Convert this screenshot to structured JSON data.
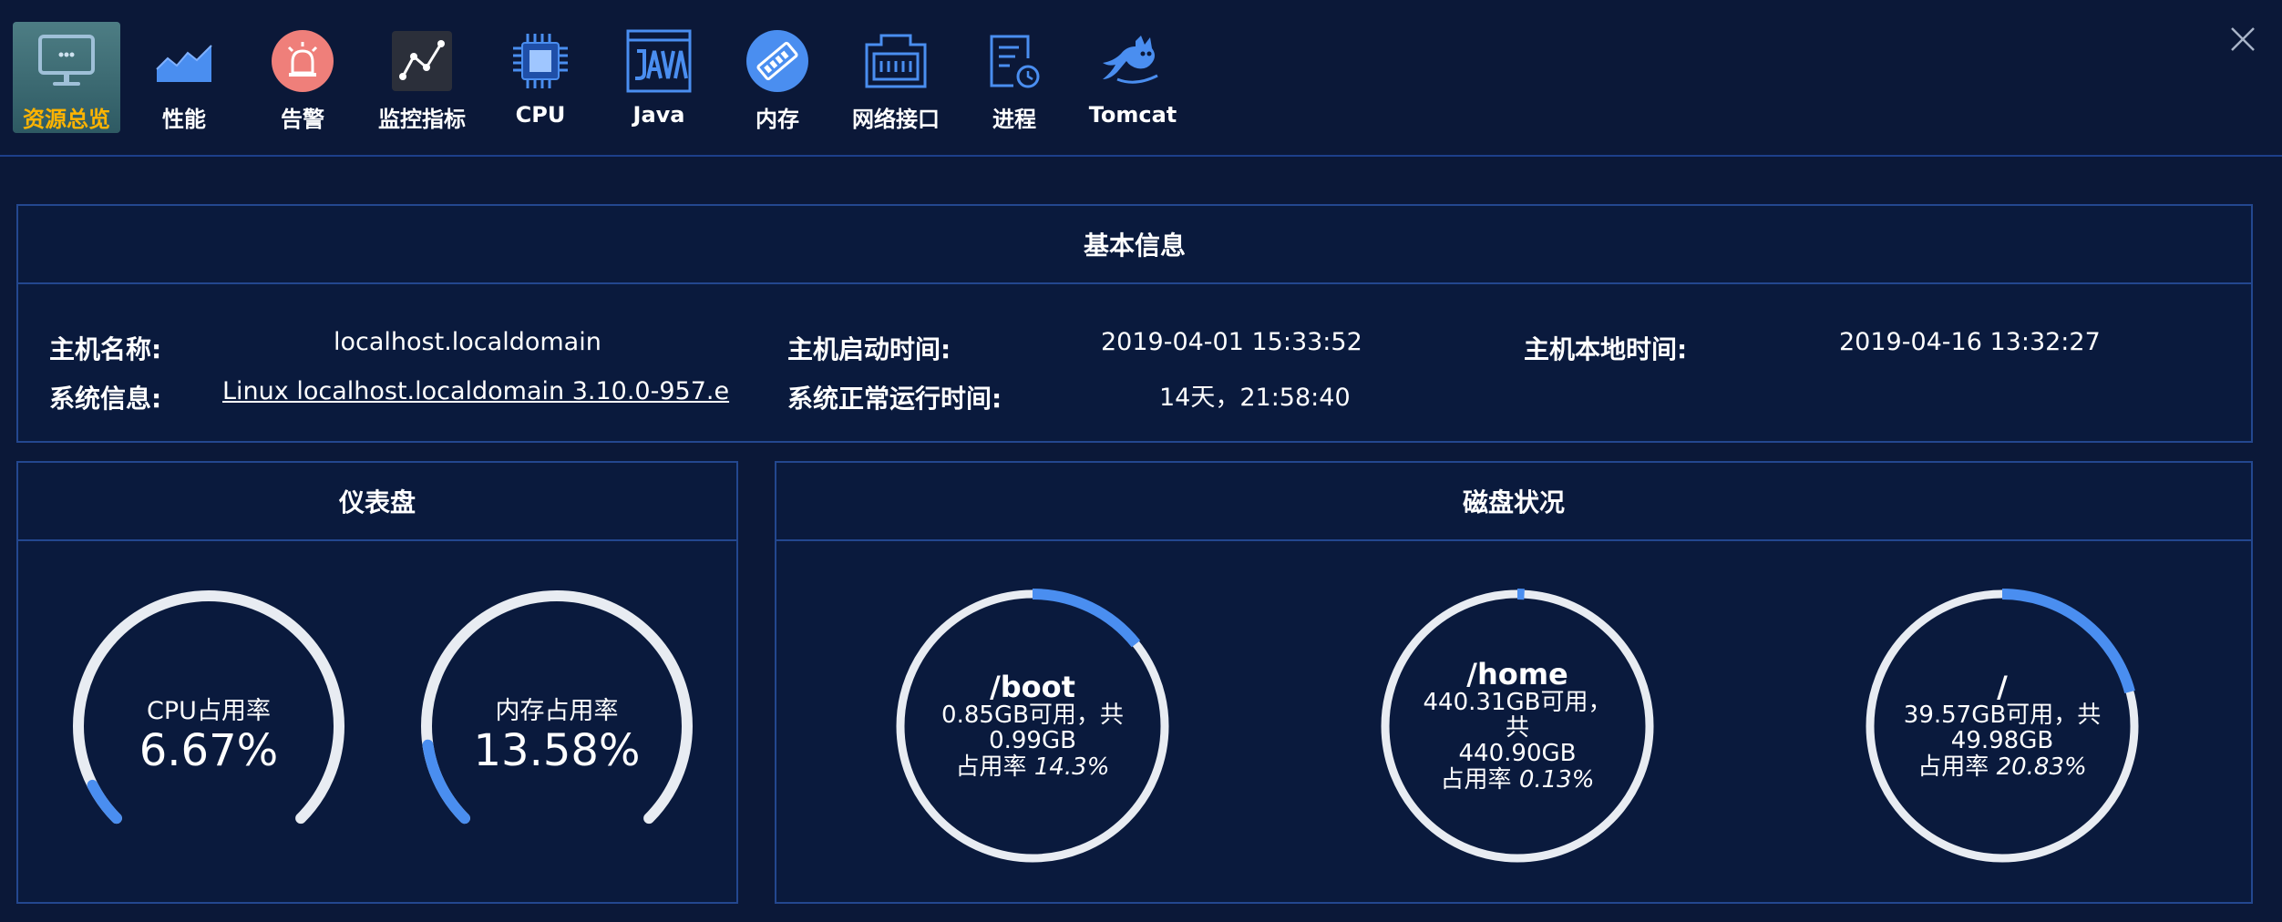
{
  "toolbar": {
    "items": [
      {
        "label": "资源总览",
        "icon": "monitor-icon",
        "active": true
      },
      {
        "label": "性能",
        "icon": "area-chart-icon",
        "active": false
      },
      {
        "label": "告警",
        "icon": "alarm-icon",
        "active": false
      },
      {
        "label": "监控指标",
        "icon": "line-chart-icon",
        "active": false
      },
      {
        "label": "CPU",
        "icon": "cpu-chip-icon",
        "active": false
      },
      {
        "label": "Java",
        "icon": "java-icon",
        "active": false
      },
      {
        "label": "内存",
        "icon": "memory-icon",
        "active": false
      },
      {
        "label": "网络接口",
        "icon": "network-port-icon",
        "active": false
      },
      {
        "label": "进程",
        "icon": "process-icon",
        "active": false
      },
      {
        "label": "Tomcat",
        "icon": "tomcat-icon",
        "active": false
      }
    ]
  },
  "basic_info": {
    "title": "基本信息",
    "hostname_label": "主机名称:",
    "hostname": "localhost.localdomain",
    "boot_time_label": "主机启动时间:",
    "boot_time": "2019-04-01 15:33:52",
    "local_time_label": "主机本地时间:",
    "local_time": "2019-04-16 13:32:27",
    "sysinfo_label": "系统信息:",
    "sysinfo": "Linux localhost.localdomain 3.10.0-957.e",
    "uptime_label": "系统正常运行时间:",
    "uptime": "14天，21:58:40"
  },
  "dashboard": {
    "title": "仪表盘",
    "gauges": [
      {
        "title": "CPU占用率",
        "value": "6.67%",
        "fraction": 0.0667
      },
      {
        "title": "内存占用率",
        "value": "13.58%",
        "fraction": 0.1358
      }
    ]
  },
  "disk": {
    "title": "磁盘状况",
    "items": [
      {
        "name": "/boot",
        "line1": "0.85GB可用，共",
        "line2": "0.99GB",
        "rate_label": "占用率",
        "rate": "14.3%",
        "fraction": 0.143
      },
      {
        "name": "/home",
        "line1": "440.31GB可用，共",
        "line2": "440.90GB",
        "rate_label": "占用率",
        "rate": "0.13%",
        "fraction": 0.0013
      },
      {
        "name": "/",
        "line1": "39.57GB可用，共",
        "line2": "49.98GB",
        "rate_label": "占用率",
        "rate": "20.83%",
        "fraction": 0.2083
      }
    ]
  },
  "colors": {
    "background": "#0b1838",
    "border": "#23478f",
    "track": "#e8ecf2",
    "progress": "#4a8ef0",
    "active_label": "#ffb400"
  }
}
